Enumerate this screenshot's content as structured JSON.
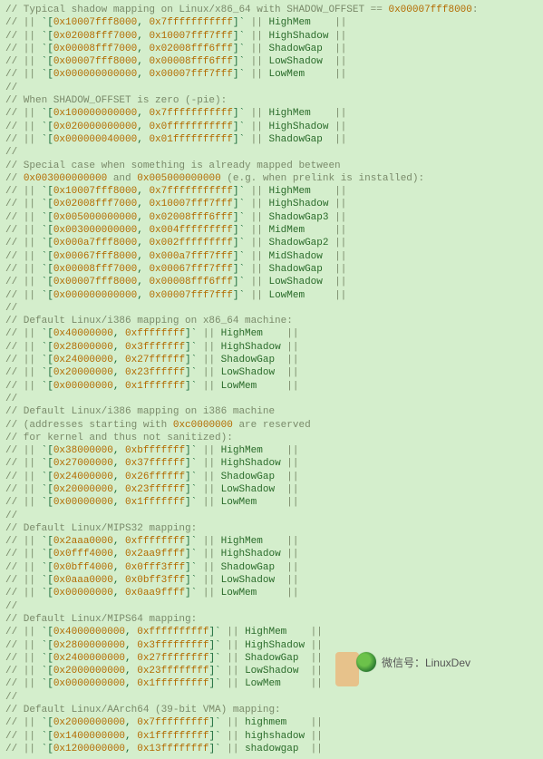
{
  "watermark": {
    "label": "微信号：LinuxDev"
  },
  "lines": [
    "// Typical shadow mapping on Linux/x86_64 with SHADOW_OFFSET == 0x00007fff8000:",
    "// || `[0x10007fff8000, 0x7fffffffffff]` || HighMem    ||",
    "// || `[0x02008fff7000, 0x10007fff7fff]` || HighShadow ||",
    "// || `[0x00008fff7000, 0x02008fff6fff]` || ShadowGap  ||",
    "// || `[0x00007fff8000, 0x00008fff6fff]` || LowShadow  ||",
    "// || `[0x000000000000, 0x00007fff7fff]` || LowMem     ||",
    "//",
    "// When SHADOW_OFFSET is zero (-pie):",
    "// || `[0x100000000000, 0x7fffffffffff]` || HighMem    ||",
    "// || `[0x020000000000, 0x0fffffffffff]` || HighShadow ||",
    "// || `[0x000000040000, 0x01ffffffffff]` || ShadowGap  ||",
    "//",
    "// Special case when something is already mapped between",
    "// 0x003000000000 and 0x005000000000 (e.g. when prelink is installed):",
    "// || `[0x10007fff8000, 0x7fffffffffff]` || HighMem    ||",
    "// || `[0x02008fff7000, 0x10007fff7fff]` || HighShadow ||",
    "// || `[0x005000000000, 0x02008fff6fff]` || ShadowGap3 ||",
    "// || `[0x003000000000, 0x004fffffffff]` || MidMem     ||",
    "// || `[0x000a7fff8000, 0x002fffffffff]` || ShadowGap2 ||",
    "// || `[0x00067fff8000, 0x000a7fff7fff]` || MidShadow  ||",
    "// || `[0x00008fff7000, 0x00067fff7fff]` || ShadowGap  ||",
    "// || `[0x00007fff8000, 0x00008fff6fff]` || LowShadow  ||",
    "// || `[0x000000000000, 0x00007fff7fff]` || LowMem     ||",
    "//",
    "// Default Linux/i386 mapping on x86_64 machine:",
    "// || `[0x40000000, 0xffffffff]` || HighMem    ||",
    "// || `[0x28000000, 0x3fffffff]` || HighShadow ||",
    "// || `[0x24000000, 0x27ffffff]` || ShadowGap  ||",
    "// || `[0x20000000, 0x23ffffff]` || LowShadow  ||",
    "// || `[0x00000000, 0x1fffffff]` || LowMem     ||",
    "//",
    "// Default Linux/i386 mapping on i386 machine",
    "// (addresses starting with 0xc0000000 are reserved",
    "// for kernel and thus not sanitized):",
    "// || `[0x38000000, 0xbfffffff]` || HighMem    ||",
    "// || `[0x27000000, 0x37ffffff]` || HighShadow ||",
    "// || `[0x24000000, 0x26ffffff]` || ShadowGap  ||",
    "// || `[0x20000000, 0x23ffffff]` || LowShadow  ||",
    "// || `[0x00000000, 0x1fffffff]` || LowMem     ||",
    "//",
    "// Default Linux/MIPS32 mapping:",
    "// || `[0x2aaa0000, 0xffffffff]` || HighMem    ||",
    "// || `[0x0fff4000, 0x2aa9ffff]` || HighShadow ||",
    "// || `[0x0bff4000, 0x0fff3fff]` || ShadowGap  ||",
    "// || `[0x0aaa0000, 0x0bff3fff]` || LowShadow  ||",
    "// || `[0x00000000, 0x0aa9ffff]` || LowMem     ||",
    "//",
    "// Default Linux/MIPS64 mapping:",
    "// || `[0x4000000000, 0xffffffffff]` || HighMem    ||",
    "// || `[0x2800000000, 0x3fffffffff]` || HighShadow ||",
    "// || `[0x2400000000, 0x27ffffffff]` || ShadowGap  ||",
    "// || `[0x2000000000, 0x23ffffffff]` || LowShadow  ||",
    "// || `[0x0000000000, 0x1fffffffff]` || LowMem     ||",
    "//",
    "// Default Linux/AArch64 (39-bit VMA) mapping:",
    "// || `[0x2000000000, 0x7fffffffff]` || highmem    ||",
    "// || `[0x1400000000, 0x1fffffffff]` || highshadow ||",
    "// || `[0x1200000000, 0x13ffffffff]` || shadowgap  ||"
  ]
}
